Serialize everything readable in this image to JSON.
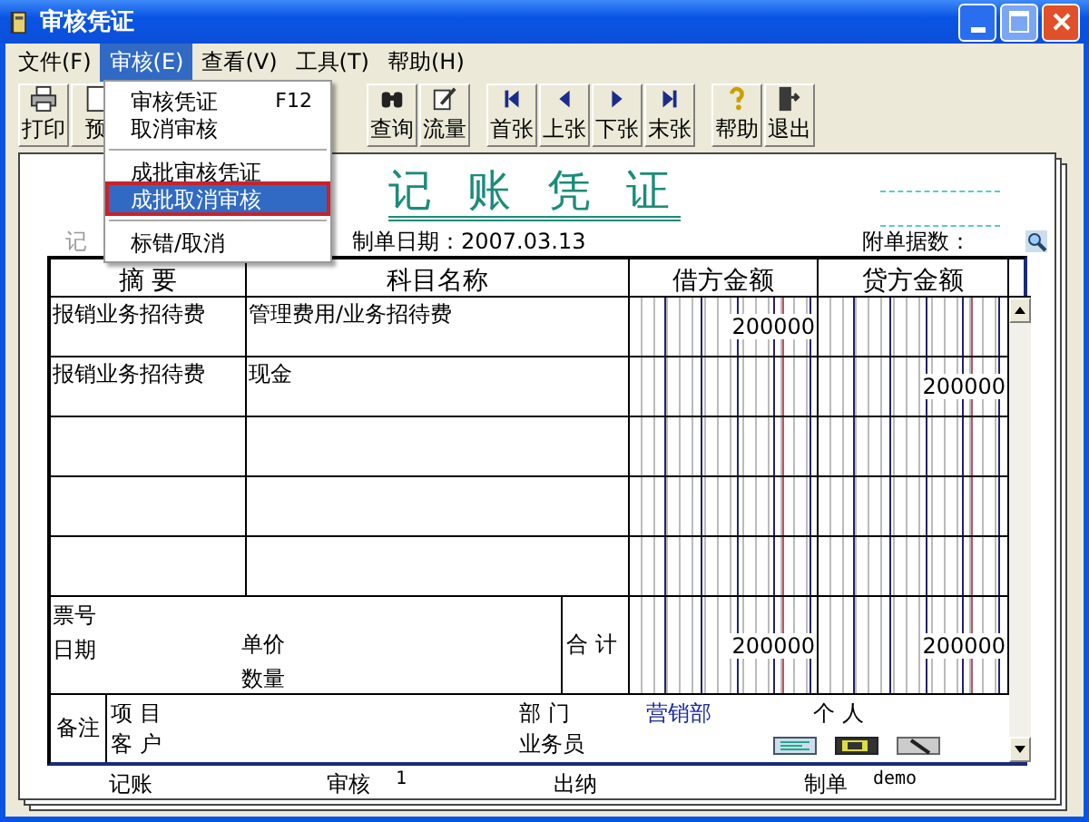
{
  "window": {
    "title": "审核凭证"
  },
  "menu": [
    {
      "label": "文件(F)",
      "selected": false
    },
    {
      "label": "审核(E)",
      "selected": true
    },
    {
      "label": "查看(V)",
      "selected": false
    },
    {
      "label": "工具(T)",
      "selected": false
    },
    {
      "label": "帮助(H)",
      "selected": false
    }
  ],
  "dropdown": [
    {
      "kind": "item",
      "label": "审核凭证",
      "shortcut": "F12",
      "selected": false
    },
    {
      "kind": "item",
      "label": "取消审核",
      "selected": false
    },
    {
      "kind": "separator"
    },
    {
      "kind": "item",
      "label": "成批审核凭证",
      "selected": false
    },
    {
      "kind": "item",
      "label": "成批取消审核",
      "selected": true
    },
    {
      "kind": "separator"
    },
    {
      "kind": "item",
      "label": "标错/取消",
      "selected": false
    }
  ],
  "toolbar": [
    {
      "kind": "print",
      "label": "打印"
    },
    {
      "kind": "preview",
      "label": "预"
    },
    {
      "kind": "query",
      "label": "查询"
    },
    {
      "kind": "flow",
      "label": "流量"
    },
    {
      "kind": "first",
      "label": "首张"
    },
    {
      "kind": "prev",
      "label": "上张"
    },
    {
      "kind": "next",
      "label": "下张"
    },
    {
      "kind": "last",
      "label": "末张"
    },
    {
      "kind": "help",
      "label": "帮助"
    },
    {
      "kind": "exit",
      "label": "退出"
    }
  ],
  "voucher": {
    "title": "记 账 凭 证",
    "type_label": "记",
    "date": "制单日期：2007.03.13",
    "attachments": "附单据数：",
    "columns": [
      "摘 要",
      "科目名称",
      "借方金额",
      "贷方金额"
    ],
    "rows": [
      {
        "summary": "报销业务招待费",
        "account": "管理费用/业务招待费",
        "debit": "200000"
      },
      {
        "summary": "报销业务招待费",
        "account": "现金",
        "credit": "200000"
      },
      {},
      {},
      {}
    ],
    "total": {
      "ticket_no": "票号",
      "date": "日期",
      "unit_price": "单价",
      "quantity": "数量",
      "label": "合 计",
      "debit": "200000",
      "credit": "200000"
    },
    "notes": {
      "label": "备注",
      "project": "项 目",
      "customer": "客 户",
      "department": "部 门",
      "department_value": "营销部",
      "person": "个 人",
      "salesperson": "业务员"
    },
    "signatures": [
      {
        "label": "记账"
      },
      {
        "label": "审核",
        "value": "1"
      },
      {
        "label": "出纳"
      },
      {
        "label": "制单",
        "value": "demo"
      }
    ]
  }
}
